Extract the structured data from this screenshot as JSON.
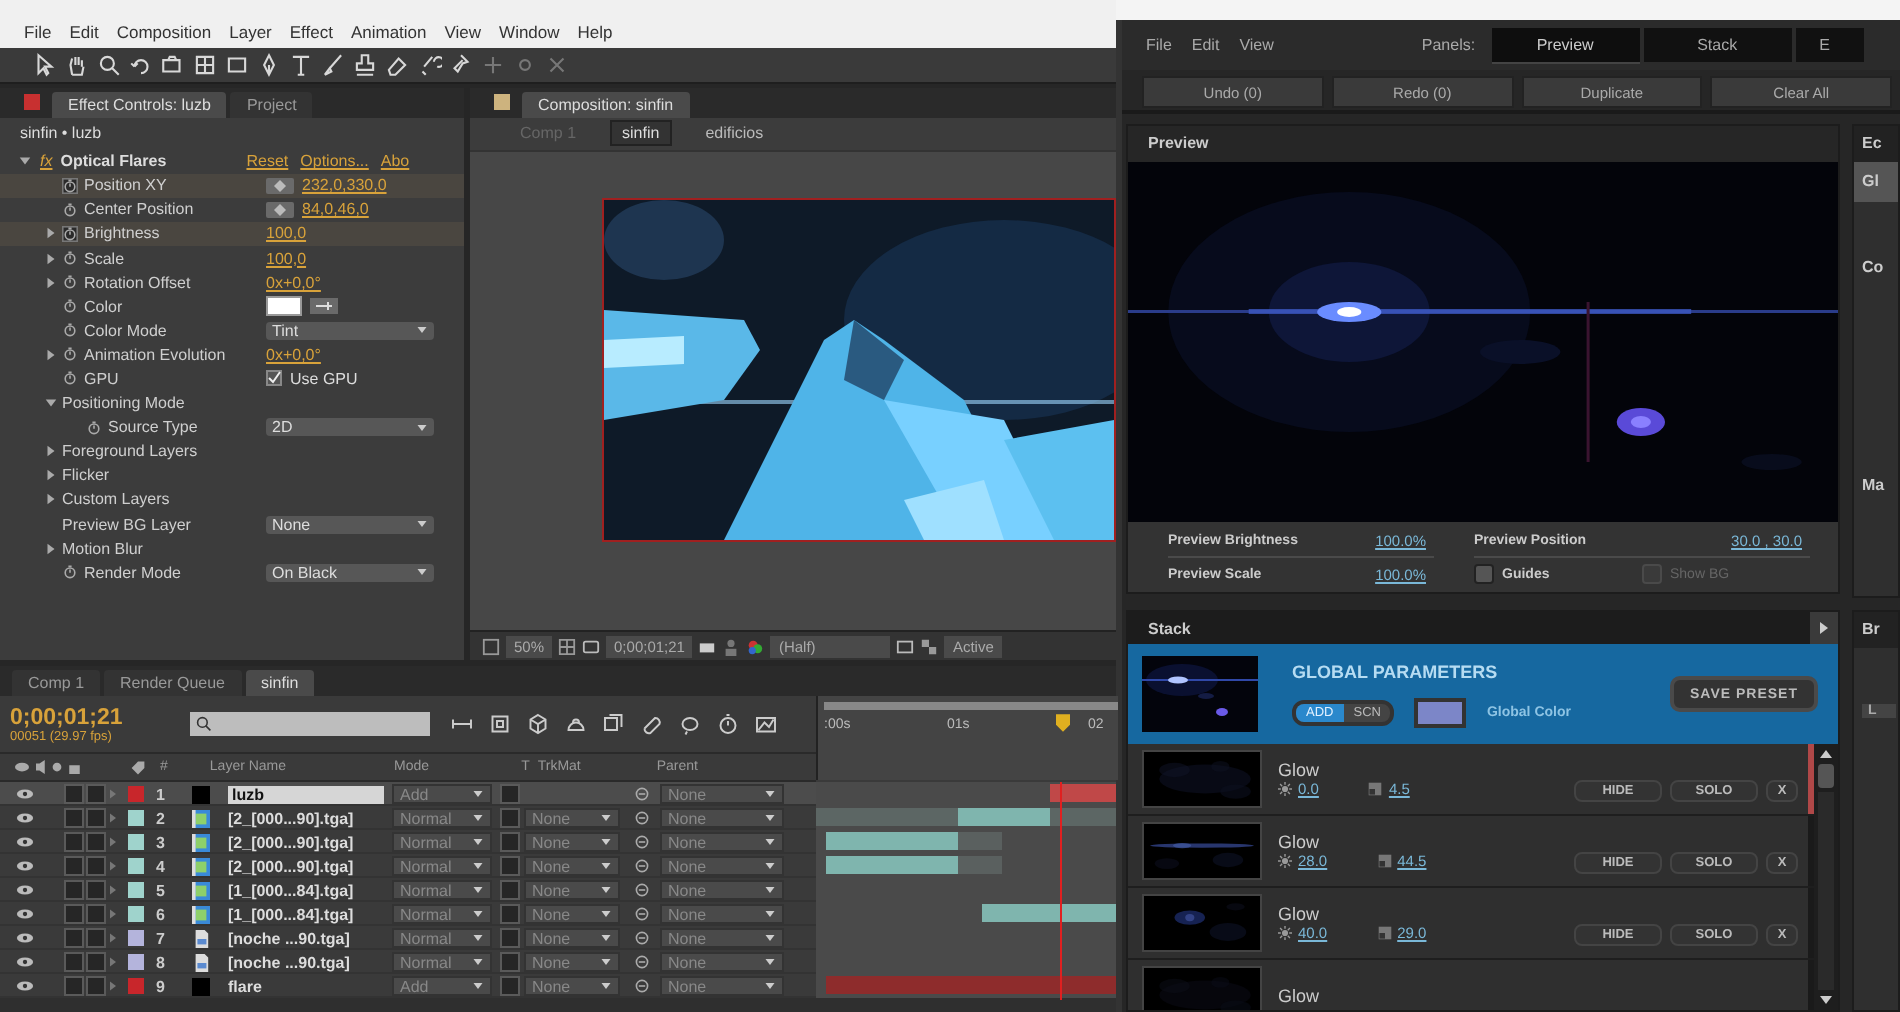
{
  "after_effects": {
    "menu": [
      "File",
      "Edit",
      "Composition",
      "Layer",
      "Effect",
      "Animation",
      "View",
      "Window",
      "Help"
    ],
    "effect_controls": {
      "tabs": [
        {
          "label": "Effect Controls: luzb",
          "selected": true
        },
        {
          "label": "Project",
          "selected": false
        }
      ],
      "breadcrumb": "sinfin • luzb",
      "effect": {
        "badge": "fx",
        "name": "Optical Flares",
        "links": [
          "Reset",
          "Options...",
          "Abo"
        ]
      },
      "properties": [
        {
          "name": "Position XY",
          "kind": "point",
          "value": "232,0,330,0",
          "keyframed": true
        },
        {
          "name": "Center Position",
          "kind": "point",
          "value": "84,0,46,0",
          "keyframed": false
        },
        {
          "name": "Brightness",
          "kind": "number",
          "value": "100,0",
          "keyframed": true,
          "expanded": false
        },
        {
          "name": "Scale",
          "kind": "number",
          "value": "100,0",
          "keyframed": false,
          "expanded": false
        },
        {
          "name": "Rotation Offset",
          "kind": "number",
          "value": "0x+0,0°",
          "keyframed": false,
          "expanded": false
        },
        {
          "name": "Color",
          "kind": "color",
          "color": "#ffffff",
          "keyframed": false
        },
        {
          "name": "Color Mode",
          "kind": "dropdown",
          "value": "Tint",
          "keyframed": false
        },
        {
          "name": "Animation Evolution",
          "kind": "number",
          "value": "0x+0,0°",
          "keyframed": false,
          "expanded": false
        },
        {
          "name": "GPU",
          "kind": "checkbox",
          "value": "Use GPU",
          "checked": true,
          "keyframed": false
        },
        {
          "name": "Positioning Mode",
          "kind": "group",
          "expanded": true,
          "children": [
            {
              "name": "Source Type",
              "kind": "dropdown",
              "value": "2D",
              "keyframed": false
            }
          ]
        },
        {
          "name": "Foreground Layers",
          "kind": "group",
          "expanded": false
        },
        {
          "name": "Flicker",
          "kind": "group",
          "expanded": false
        },
        {
          "name": "Custom Layers",
          "kind": "group",
          "expanded": false
        },
        {
          "name": "Preview BG Layer",
          "kind": "dropdown",
          "value": "None"
        },
        {
          "name": "Motion Blur",
          "kind": "group",
          "expanded": false
        },
        {
          "name": "Render Mode",
          "kind": "dropdown",
          "value": "On Black",
          "keyframed": false
        }
      ]
    },
    "composition": {
      "tab": "Composition: sinfin",
      "breadcrumbs": [
        {
          "label": "Comp 1",
          "selected": false
        },
        {
          "label": "sinfin",
          "selected": true
        },
        {
          "label": "edificios",
          "selected": false
        }
      ],
      "footer": {
        "zoom": "50%",
        "timecode": "0;00;01;21",
        "resolution": "(Half)",
        "view": "Active"
      }
    },
    "timeline": {
      "tabs": [
        {
          "label": "Comp 1",
          "selected": false
        },
        {
          "label": "Render Queue",
          "selected": false
        },
        {
          "label": "sinfin",
          "selected": true
        }
      ],
      "timecode": "0;00;01;21",
      "frames": "00051 (29.97 fps)",
      "columns": [
        "#",
        "Layer Name",
        "Mode",
        "T",
        "TrkMat",
        "Parent"
      ],
      "ruler": [
        ":00s",
        "01s",
        "02"
      ],
      "layers": [
        {
          "number": "1",
          "name": "luzb",
          "kind": "solid",
          "color": "#c8262b",
          "mode": "Add",
          "parent": "None",
          "selected": true,
          "renaming": true
        },
        {
          "number": "2",
          "name": "[2_[000...90].tga]",
          "kind": "sequence",
          "color": "#9fd3cc",
          "mode": "Normal",
          "trkmat": "None",
          "parent": "None",
          "selected": false,
          "renaming": false
        },
        {
          "number": "3",
          "name": "[2_[000...90].tga]",
          "kind": "sequence",
          "color": "#9fd3cc",
          "mode": "Normal",
          "trkmat": "None",
          "parent": "None",
          "selected": false,
          "renaming": false
        },
        {
          "number": "4",
          "name": "[2_[000...90].tga]",
          "kind": "sequence",
          "color": "#9fd3cc",
          "mode": "Normal",
          "trkmat": "None",
          "parent": "None",
          "selected": false,
          "renaming": false
        },
        {
          "number": "5",
          "name": "[1_[000...84].tga]",
          "kind": "sequence",
          "color": "#9fd3cc",
          "mode": "Normal",
          "trkmat": "None",
          "parent": "None",
          "selected": false,
          "renaming": false
        },
        {
          "number": "6",
          "name": "[1_[000...84].tga]",
          "kind": "sequence",
          "color": "#9fd3cc",
          "mode": "Normal",
          "trkmat": "None",
          "parent": "None",
          "selected": false,
          "renaming": false
        },
        {
          "number": "7",
          "name": "[noche ...90.tga]",
          "kind": "still",
          "color": "#b4b4dc",
          "mode": "Normal",
          "trkmat": "None",
          "parent": "None",
          "selected": false,
          "renaming": false
        },
        {
          "number": "8",
          "name": "[noche ...90.tga]",
          "kind": "still",
          "color": "#b4b4dc",
          "mode": "Normal",
          "trkmat": "None",
          "parent": "None",
          "selected": false,
          "renaming": false
        },
        {
          "number": "9",
          "name": "flare",
          "kind": "solid",
          "color": "#c8262b",
          "mode": "Add",
          "trkmat": "None",
          "parent": "None",
          "selected": false,
          "renaming": false
        }
      ]
    }
  },
  "optical_flares": {
    "menu": [
      "File",
      "Edit",
      "View"
    ],
    "panels_label": "Panels:",
    "panel_tabs": [
      {
        "label": "Preview",
        "selected": true
      },
      {
        "label": "Stack",
        "selected": false
      },
      {
        "label": "E",
        "selected": false
      }
    ],
    "actions": [
      "Undo (0)",
      "Redo (0)",
      "Duplicate",
      "Clear All"
    ],
    "preview": {
      "title": "Preview",
      "fields": [
        {
          "label": "Preview Brightness",
          "value": "100.0%"
        },
        {
          "label": "Preview Position",
          "value": "30.0 , 30.0"
        },
        {
          "label": "Preview Scale",
          "value": "100.0%"
        }
      ],
      "checkboxes": [
        {
          "label": "Guides",
          "checked": false,
          "disabled": false
        },
        {
          "label": "Show BG",
          "checked": false,
          "disabled": true
        }
      ]
    },
    "side_panel": {
      "upper": [
        "Ec",
        "Gl",
        "Co",
        "Ma"
      ],
      "lower": [
        "Br",
        "L"
      ]
    },
    "stack": {
      "title": "Stack",
      "global": {
        "title": "GLOBAL PARAMETERS",
        "blend": [
          {
            "label": "ADD",
            "selected": true
          },
          {
            "label": "SCN",
            "selected": false
          }
        ],
        "color_label": "Global Color",
        "color": "#7c86c8",
        "save": "SAVE PRESET"
      },
      "elements": [
        {
          "name": "Glow",
          "brightness": "0.0",
          "scale": "4.5",
          "buttons": [
            "HIDE",
            "SOLO",
            "X"
          ],
          "selected": true
        },
        {
          "name": "Glow",
          "brightness": "28.0",
          "scale": "44.5",
          "buttons": [
            "HIDE",
            "SOLO",
            "X"
          ],
          "selected": false
        },
        {
          "name": "Glow",
          "brightness": "40.0",
          "scale": "29.0",
          "buttons": [
            "HIDE",
            "SOLO",
            "X"
          ],
          "selected": false
        },
        {
          "name": "Glow",
          "selected": false
        }
      ]
    }
  }
}
